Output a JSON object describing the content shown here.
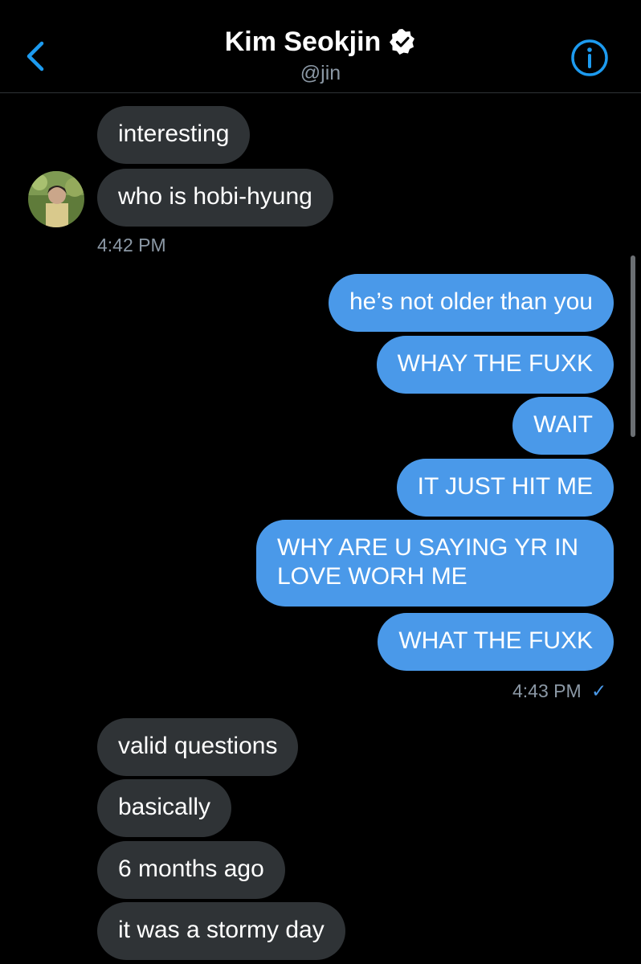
{
  "header": {
    "title": "Kim Seokjin",
    "handle": "@jin",
    "back_icon": "chevron-left-icon",
    "verified_icon": "verified-badge-icon",
    "info_icon": "info-icon",
    "accent_color": "#1d9bf0"
  },
  "messages": {
    "in_1": "interesting",
    "in_2": "who is hobi-hyung",
    "time_1": "4:42 PM",
    "out_1": "he’s not older than you",
    "out_2": "WHAY THE FUXK",
    "out_3": "WAIT",
    "out_4": "IT JUST HIT ME",
    "out_5": "WHY ARE U SAYING YR IN LOVE WORH ME",
    "out_6": "WHAT THE FUXK",
    "time_2": "4:43 PM",
    "time_2_status": "✓",
    "in_3": "valid questions",
    "in_4": "basically",
    "in_5": "6 months ago",
    "in_6": "it was a stormy day"
  },
  "colors": {
    "incoming_bubble": "#2f3336",
    "outgoing_bubble": "#4a99e9",
    "background": "#000000"
  }
}
